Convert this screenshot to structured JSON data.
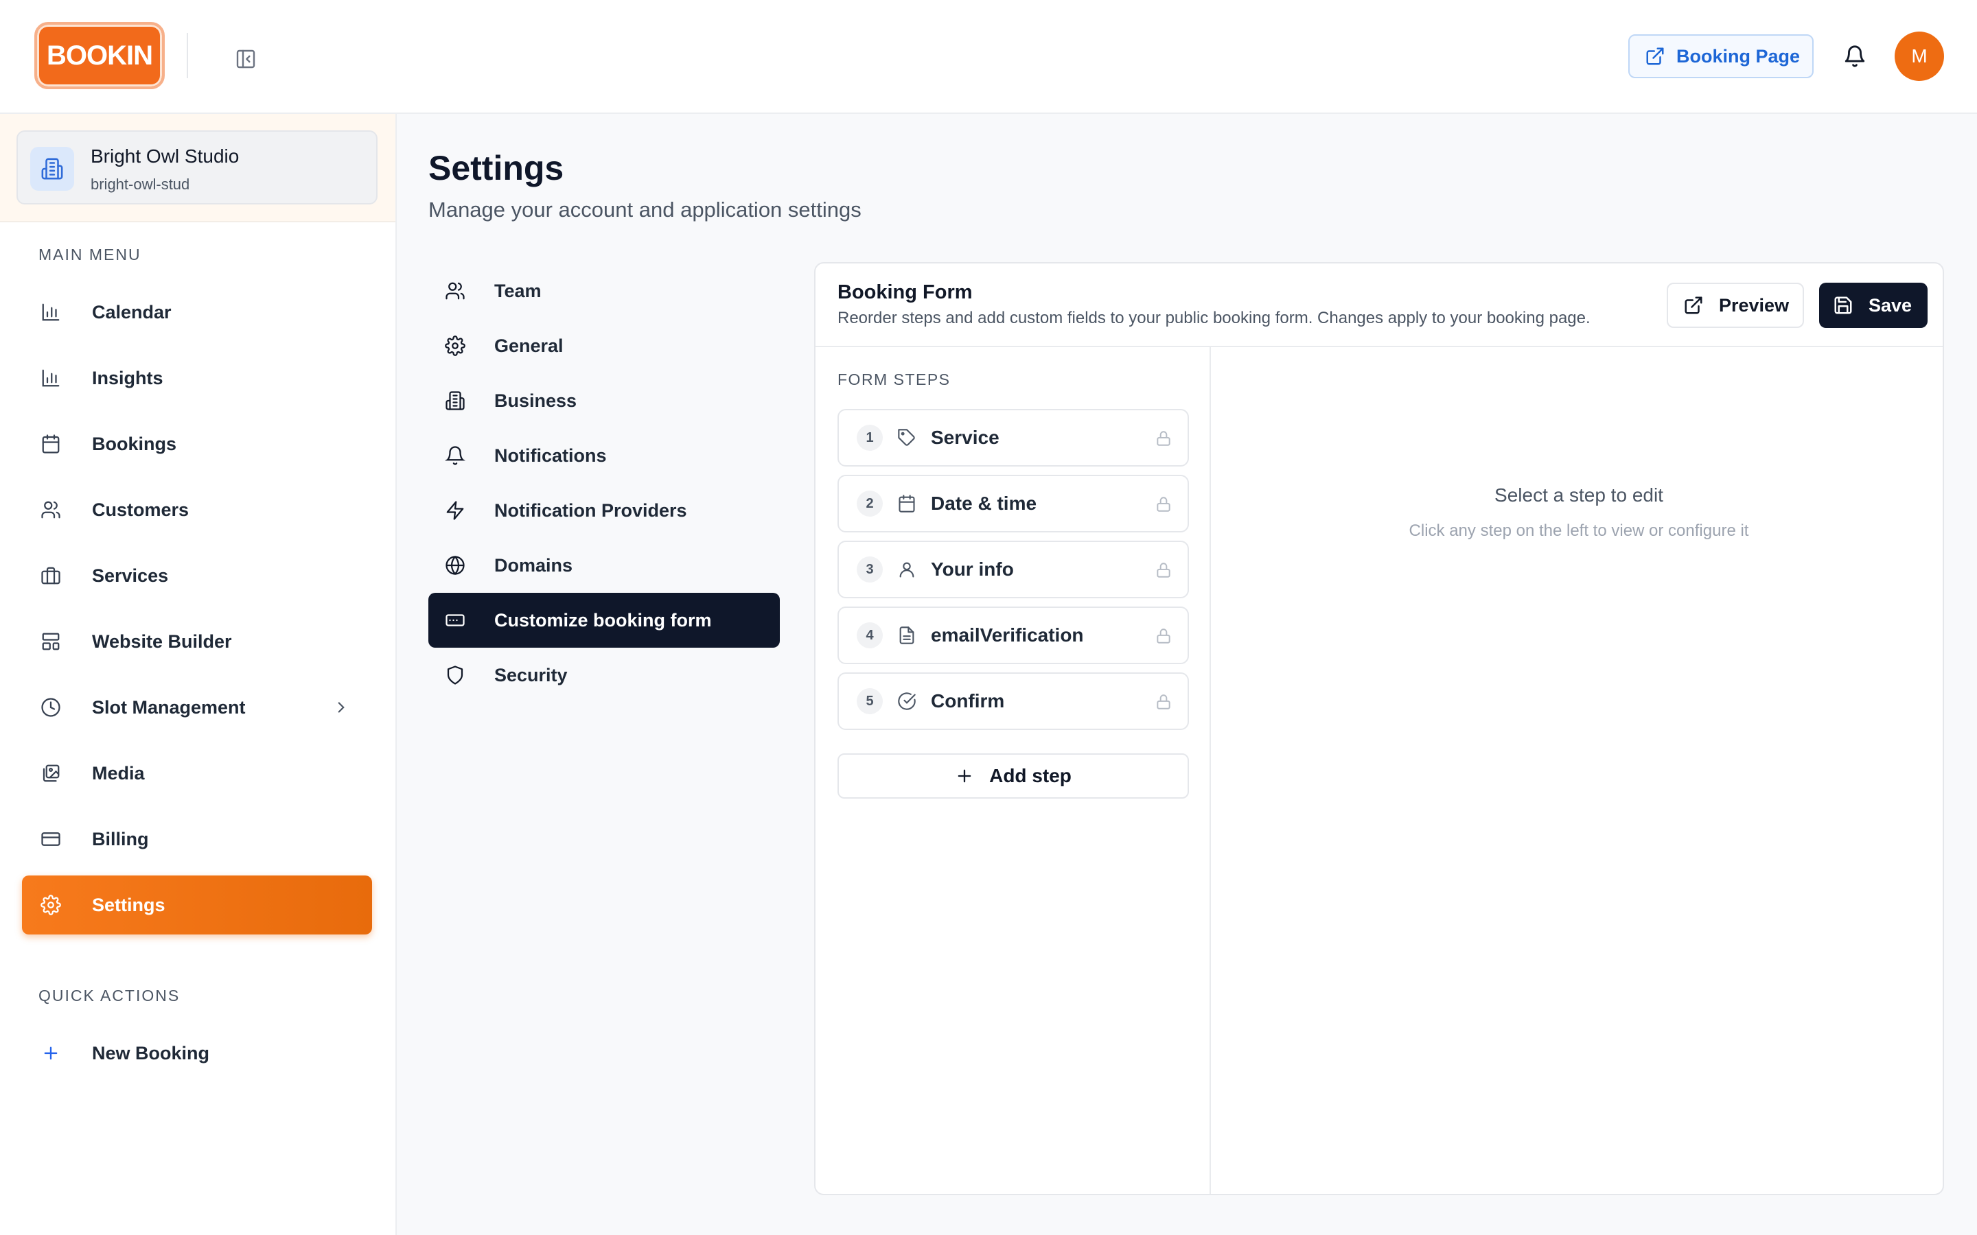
{
  "header": {
    "logo_text": "BOOKIN",
    "booking_page_label": "Booking Page",
    "avatar_initial": "M"
  },
  "sidebar": {
    "org": {
      "name": "Bright Owl Studio",
      "slug": "bright-owl-stud"
    },
    "main_menu_label": "MAIN MENU",
    "items": [
      {
        "label": "Calendar",
        "icon": "bar-chart-icon"
      },
      {
        "label": "Insights",
        "icon": "bar-chart-icon"
      },
      {
        "label": "Bookings",
        "icon": "calendar-icon"
      },
      {
        "label": "Customers",
        "icon": "users-icon"
      },
      {
        "label": "Services",
        "icon": "briefcase-icon"
      },
      {
        "label": "Website Builder",
        "icon": "layout-icon"
      },
      {
        "label": "Slot Management",
        "icon": "clock-icon"
      },
      {
        "label": "Media",
        "icon": "images-icon"
      },
      {
        "label": "Billing",
        "icon": "credit-card-icon"
      },
      {
        "label": "Settings",
        "icon": "gear-icon",
        "active": true
      }
    ],
    "quick_actions_label": "QUICK ACTIONS",
    "quick_actions": [
      {
        "label": "New Booking",
        "icon": "plus-icon"
      }
    ]
  },
  "main": {
    "title": "Settings",
    "subtitle": "Manage your account and application settings",
    "settings_nav": [
      {
        "label": "Team",
        "icon": "users-icon"
      },
      {
        "label": "General",
        "icon": "gear-icon"
      },
      {
        "label": "Business",
        "icon": "building-icon"
      },
      {
        "label": "Notifications",
        "icon": "bell-icon"
      },
      {
        "label": "Notification Providers",
        "icon": "bolt-icon"
      },
      {
        "label": "Domains",
        "icon": "globe-icon"
      },
      {
        "label": "Customize booking form",
        "icon": "form-input-icon",
        "active": true
      },
      {
        "label": "Security",
        "icon": "shield-icon"
      }
    ],
    "panel": {
      "title": "Booking Form",
      "description": "Reorder steps and add custom fields to your public booking form. Changes apply to your booking page.",
      "preview_label": "Preview",
      "save_label": "Save",
      "steps_label": "FORM STEPS",
      "steps": [
        {
          "number": "1",
          "label": "Service",
          "icon": "tag-icon"
        },
        {
          "number": "2",
          "label": "Date & time",
          "icon": "calendar-icon"
        },
        {
          "number": "3",
          "label": "Your info",
          "icon": "user-icon"
        },
        {
          "number": "4",
          "label": "emailVerification",
          "icon": "file-text-icon"
        },
        {
          "number": "5",
          "label": "Confirm",
          "icon": "check-circle-icon"
        }
      ],
      "add_step_label": "Add step",
      "empty_title": "Select a step to edit",
      "empty_subtitle": "Click any step on the left to view or configure it"
    }
  },
  "colors": {
    "brand_orange": "#f26a1b",
    "accent_blue": "#1d66d6",
    "dark_navy": "#0f172a"
  }
}
